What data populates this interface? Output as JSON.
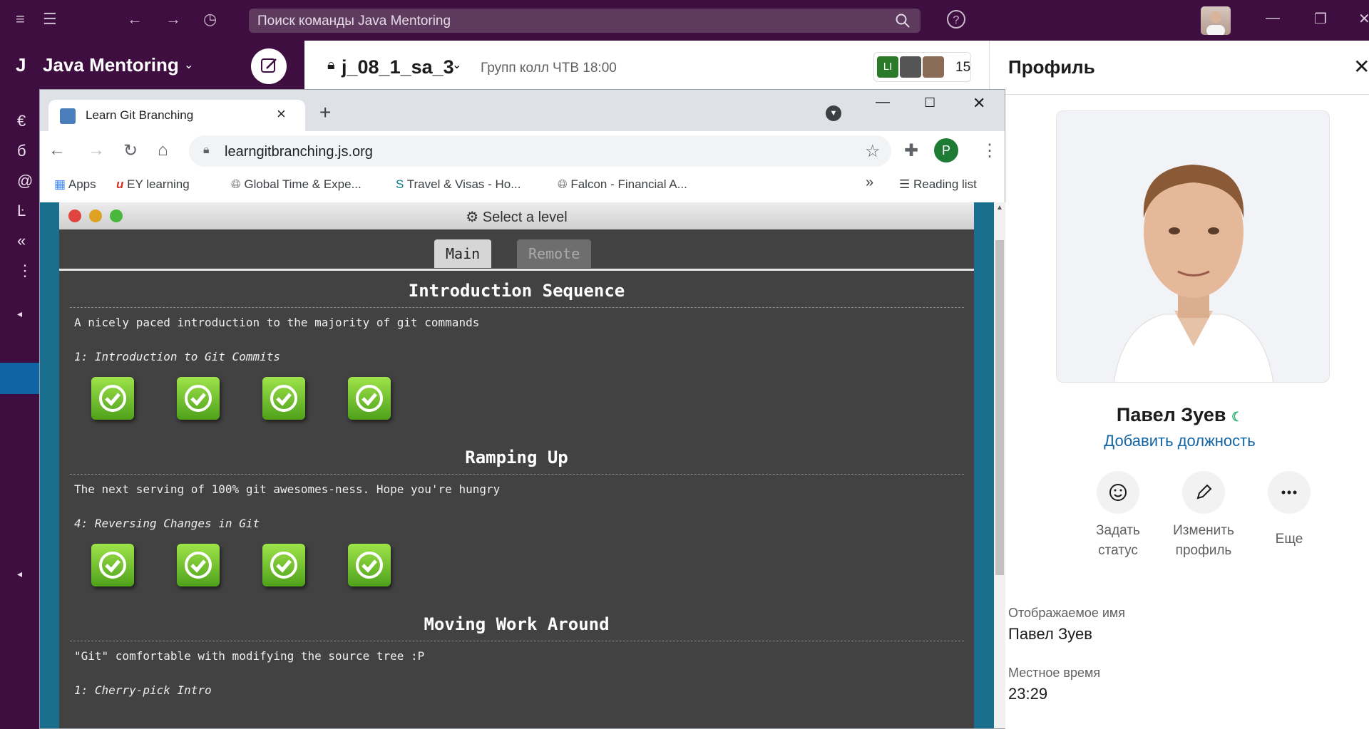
{
  "slack": {
    "search_placeholder": "Поиск команды Java Mentoring",
    "workspace_name": "Java Mentoring",
    "workspace_initial": "J",
    "channel": {
      "name": "j_08_1_sa_3",
      "topic": "Групп колл ЧТВ 18:00",
      "member_initials": "LI",
      "member_count": "15"
    },
    "sidebar_glyphs": [
      "€",
      "б",
      "@",
      "Ŀ",
      "«",
      "⋮",
      "◂",
      "◂"
    ]
  },
  "profile": {
    "title": "Профиль",
    "name": "Павел Зуев",
    "add_title": "Добавить должность",
    "actions": [
      {
        "label1": "Задать",
        "label2": "статус",
        "icon": "smile-icon"
      },
      {
        "label1": "Изменить",
        "label2": "профиль",
        "icon": "pencil-icon"
      },
      {
        "label1": "Еще",
        "label2": "",
        "icon": "more-icon"
      }
    ],
    "display_name_label": "Отображаемое имя",
    "display_name_value": "Павел Зуев",
    "local_time_label": "Местное время",
    "local_time_value": "23:29"
  },
  "browser": {
    "tab_title": "Learn Git Branching",
    "url": "learngitbranching.js.org",
    "profile_initial": "P",
    "bookmarks": [
      "Apps",
      "EY learning",
      "Global Time & Expe...",
      "Travel & Visas - Ho...",
      "Falcon - Financial A..."
    ],
    "reading_list": "Reading list",
    "overflow": "»"
  },
  "git_app": {
    "dialog_title": "Select a level",
    "tabs": [
      "Main",
      "Remote"
    ],
    "sequences": [
      {
        "title": "Introduction Sequence",
        "desc": "A nicely paced introduction to the majority of git commands",
        "level": "1: Introduction to Git Commits",
        "completed": 4
      },
      {
        "title": "Ramping Up",
        "desc": "The next serving of 100% git awesomes-ness. Hope you're hungry",
        "level": "4: Reversing Changes in Git",
        "completed": 4
      },
      {
        "title": "Moving Work Around",
        "desc": "\"Git\" comfortable with modifying the source tree :P",
        "level": "1: Cherry-pick Intro",
        "completed": 0
      }
    ]
  }
}
